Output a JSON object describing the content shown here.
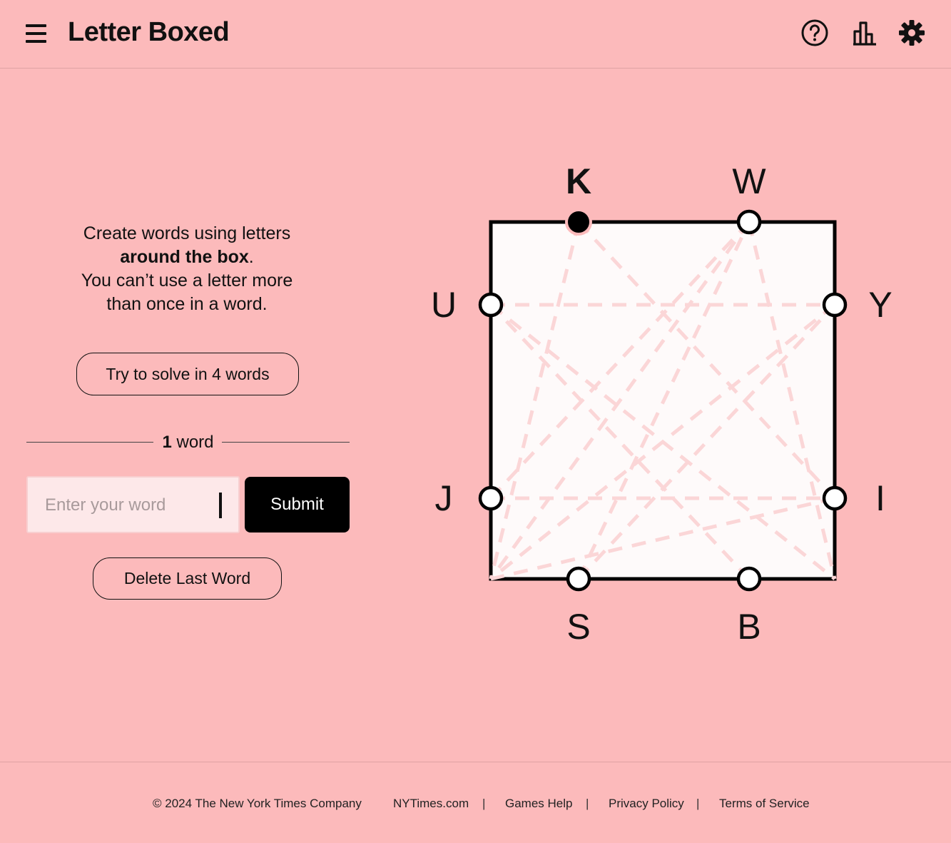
{
  "header": {
    "title": "Letter Boxed",
    "icons": [
      "menu-icon",
      "help-icon",
      "stats-icon",
      "settings-icon"
    ]
  },
  "instructions": {
    "line1": "Create words using letters",
    "line2_bold": "around the box",
    "line2_end": ".",
    "line3": "You can’t use a letter more",
    "line4": "than once in a word."
  },
  "buttons": {
    "goal": "Try to solve in 4 words",
    "submit": "Submit",
    "delete": "Delete Last Word"
  },
  "word_count": {
    "number": "1",
    "label": "word"
  },
  "input": {
    "placeholder": "Enter your word"
  },
  "board": {
    "top": [
      "K",
      "W"
    ],
    "left": [
      "U",
      "J"
    ],
    "right": [
      "Y",
      "I"
    ],
    "bottom": [
      "S",
      "B"
    ],
    "selected_letter": "K"
  },
  "footer": {
    "copyright": "© 2024 The New York Times Company",
    "links": [
      "NYTimes.com",
      "Games Help",
      "Privacy Policy",
      "Terms of Service"
    ],
    "separator": "|"
  },
  "colors": {
    "background": "#fcbabb",
    "board_fill": "#fefafa",
    "accent": "#000000",
    "guide_lines": "#fbd6d7"
  }
}
